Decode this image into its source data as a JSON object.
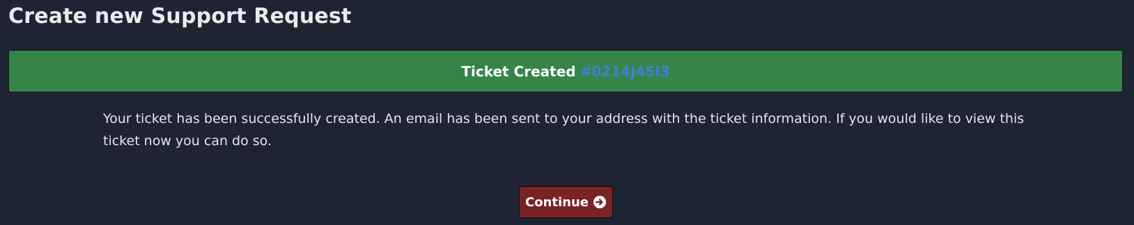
{
  "page": {
    "title": "Create new Support Request"
  },
  "banner": {
    "label": "Ticket Created",
    "ticket_number": "#0214J45I3"
  },
  "message": {
    "text": "Your ticket has been successfully created. An email has been sent to your address with the ticket information. If you would like to view this ticket now you can do so."
  },
  "actions": {
    "continue_label": "Continue",
    "continue_icon": "arrow-circle-right-icon"
  },
  "colors": {
    "background": "#1f2432",
    "banner_background": "#35844a",
    "ticket_link": "#3b82d6",
    "continue_button": "#7a2327"
  }
}
